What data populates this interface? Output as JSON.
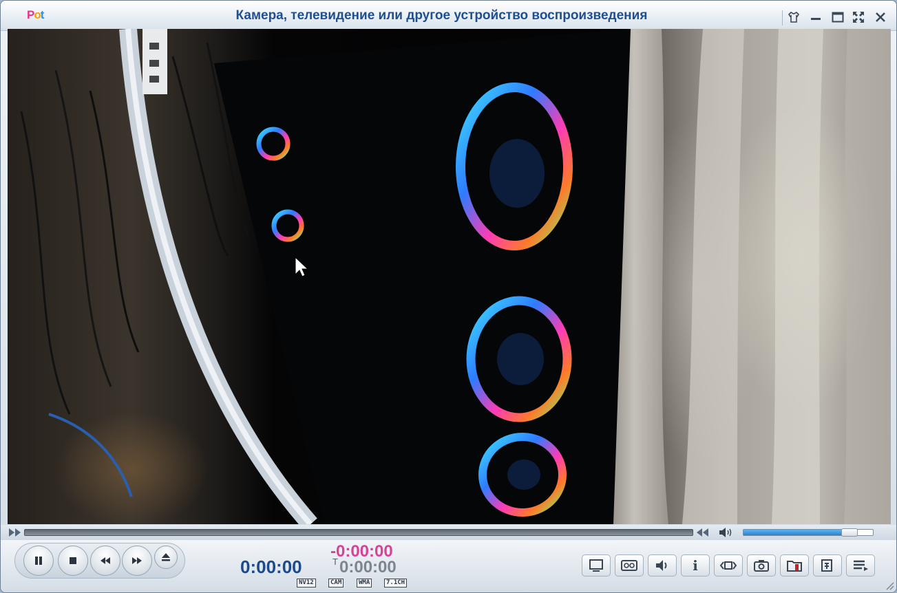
{
  "window": {
    "title": "Камера, телевидение или другое устройство воспроизведения",
    "logo": {
      "p": "P",
      "o": "o",
      "t": "t"
    }
  },
  "colors": {
    "title": "#1f4f8e",
    "time_current": "#1d4a8a",
    "time_remaining": "#d8439a",
    "volume_fill": "#2a83d1"
  },
  "titlebar_icons": [
    "skin-icon",
    "minimize-icon",
    "maximize-icon",
    "fullscreen-icon",
    "close-icon"
  ],
  "playback": {
    "current_time": "0:00:00",
    "remaining_time": "-0:00:00",
    "total_label": "T",
    "total_time": "0:00:00",
    "volume_level": 0.82
  },
  "badges": {
    "video_format": "NV12",
    "source": "CAM",
    "audio_format": "WMA",
    "channels": "7.1CH"
  },
  "controls": {
    "info_glyph": "i",
    "buttons": [
      "pause-icon",
      "stop-icon",
      "rewind-icon",
      "fast-forward-icon",
      "eject-icon"
    ],
    "right_buttons": [
      "screen-icon",
      "subtitles-icon",
      "audio-icon",
      "info-icon",
      "aspect-ratio-icon",
      "camera-icon",
      "folder-icon",
      "preferences-icon",
      "playlist-icon"
    ]
  }
}
